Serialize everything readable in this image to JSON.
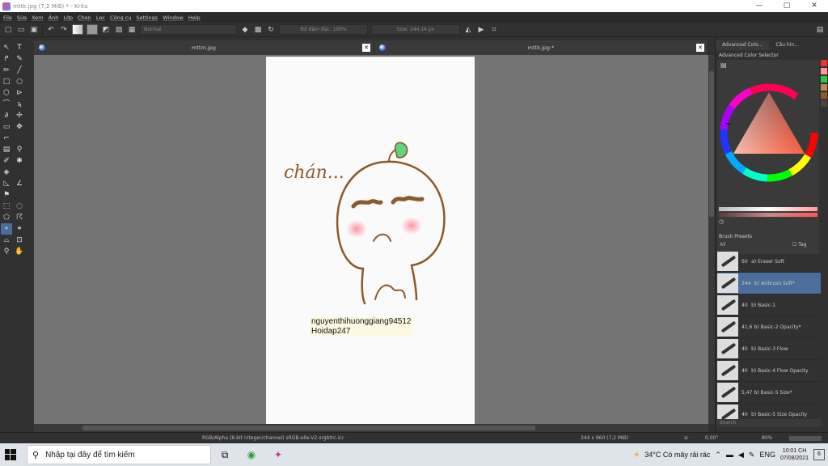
{
  "window": {
    "title": "mttk.jpg (7,2 MiB)  * - Krita",
    "minimize": "—",
    "maximize": "▢",
    "close": "✕"
  },
  "menu": [
    "File",
    "Sửa",
    "Xem",
    "Ảnh",
    "Lớp",
    "Chọn",
    "Lọc",
    "Công cụ",
    "Settings",
    "Window",
    "Help"
  ],
  "toolbar": {
    "blend_mode": "Normal",
    "opacity": "Độ đậm đặc: 100%",
    "size": "Size: 244,14 px"
  },
  "tabs": [
    {
      "title": "mttm.jpg",
      "close": "✕"
    },
    {
      "title": "mttk.jpg *",
      "close": "✕"
    }
  ],
  "canvas": {
    "sketch_text": "chán...",
    "watermark_line1": "nguyenthihuonggiang94512",
    "watermark_line2": "Hoidap247"
  },
  "dock": {
    "tabs": [
      "Advanced Colo...",
      "Cấu hìn..."
    ],
    "color_caption": "Advanced Color Selector",
    "presets_caption": "Brush Presets",
    "filter": "All",
    "tag": "Tag",
    "search_placeholder": "Search",
    "presets": [
      {
        "size": "60",
        "name": "a) Eraser Soft"
      },
      {
        "size": "244",
        "name": "b) Airbrush Soft*"
      },
      {
        "size": "40",
        "name": "b) Basic-1"
      },
      {
        "size": "41,6",
        "name": "b) Basic-2 Opacity*"
      },
      {
        "size": "40",
        "name": "b) Basic-3 Flow"
      },
      {
        "size": "40",
        "name": "b) Basic-4 Flow Opacity"
      },
      {
        "size": "5,47",
        "name": "b) Basic-5 Size*"
      },
      {
        "size": "40",
        "name": "b) Basic-5 Size Opacity"
      }
    ],
    "active_preset_index": 1,
    "accent_color": "#4b6e9c"
  },
  "status": {
    "color_model": "RGB/Alpha (8-bit integer/channel)  sRGB-elle-V2-srgbtrc.icc",
    "dimensions": "344 x 960 (7,2 MiB)",
    "rotation": "0,00°",
    "zoom": "80%"
  },
  "taskbar": {
    "search_placeholder": "Nhập tại đây để tìm kiếm",
    "weather": "34°C  Có mây rải rác",
    "language": "ENG",
    "time": "10:01 CH",
    "date": "07/08/2021",
    "notifications": "6"
  }
}
